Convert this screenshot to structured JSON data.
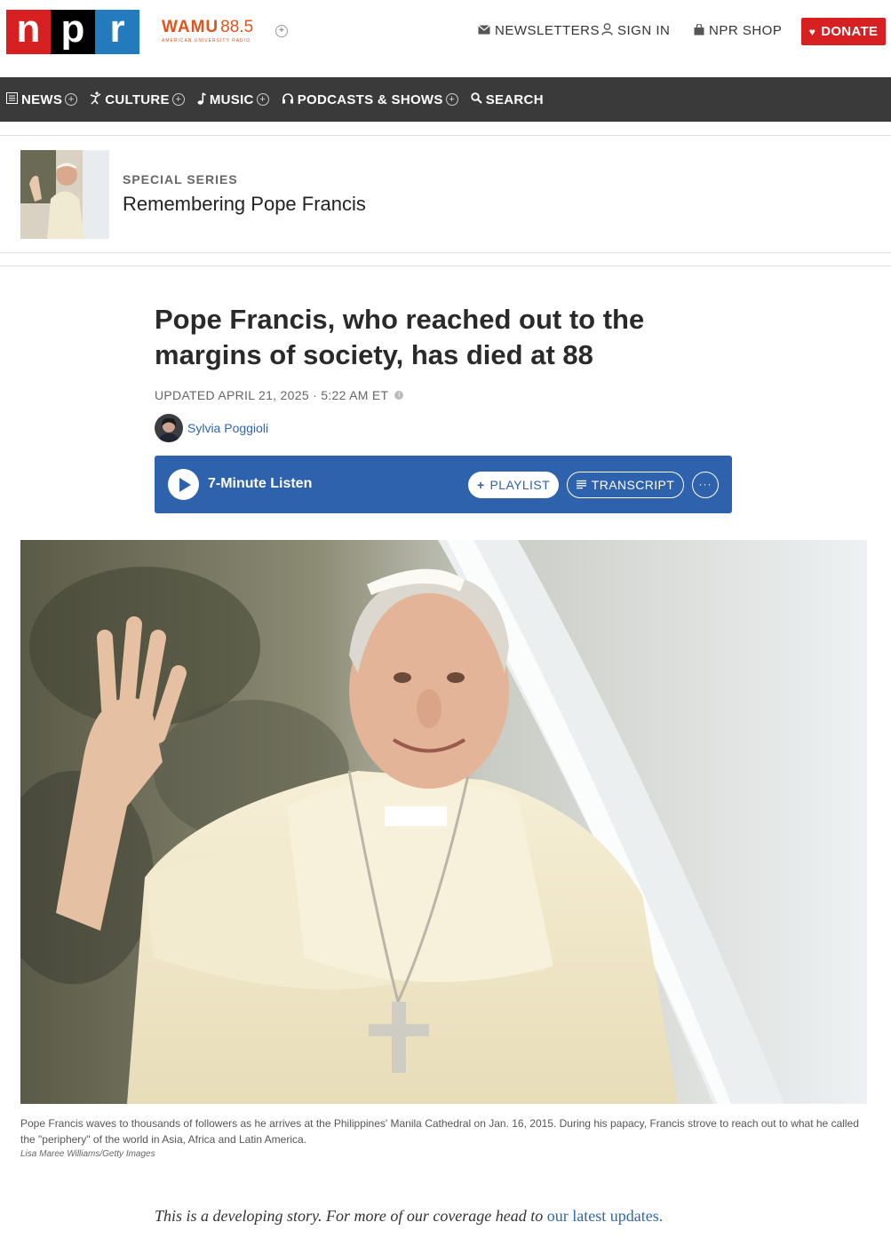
{
  "header": {
    "logo_letters": [
      "n",
      "p",
      "r"
    ],
    "station_name": "WAMU",
    "station_freq": "88.5",
    "station_sub": "American University Radio",
    "station_plus": "+",
    "newsletters": "NEWSLETTERS",
    "sign_in": "SIGN IN",
    "shop": "NPR SHOP",
    "donate": "DONATE"
  },
  "nav": {
    "items": [
      {
        "label": "NEWS",
        "plus": "+"
      },
      {
        "label": "CULTURE",
        "plus": "+"
      },
      {
        "label": "MUSIC",
        "plus": "+"
      },
      {
        "label": "PODCASTS & SHOWS",
        "plus": "+"
      },
      {
        "label": "SEARCH"
      }
    ]
  },
  "series": {
    "label": "SPECIAL SERIES",
    "title": "Remembering Pope Francis"
  },
  "article": {
    "headline": "Pope Francis, who reached out to the margins of society, has died at 88",
    "updated": "UPDATED APRIL 21, 2025 · 5:22 AM ET",
    "author": "Sylvia Poggioli"
  },
  "player": {
    "listen_label": "7-Minute Listen",
    "playlist_label": "PLAYLIST",
    "transcript_label": "TRANSCRIPT",
    "more_label": "···"
  },
  "image": {
    "caption": "Pope Francis waves to thousands of followers as he arrives at the Philippines' Manila Cathedral on Jan. 16, 2015. During his papacy, Francis strove to reach out to what he called the \"periphery\" of the world in Asia, Africa and Latin America.",
    "credit": "Lisa Maree Williams/Getty Images"
  },
  "dev_story": {
    "text": "This is a developing story. For more of our coverage head to ",
    "link": "our latest updates."
  },
  "colors": {
    "npr_red": "#d62021",
    "npr_blue": "#237bbd",
    "wamu_orange": "#e2541c",
    "nav_bg": "#3a3a3a",
    "player_bg": "#2e62ad",
    "link": "#2d66b2"
  }
}
